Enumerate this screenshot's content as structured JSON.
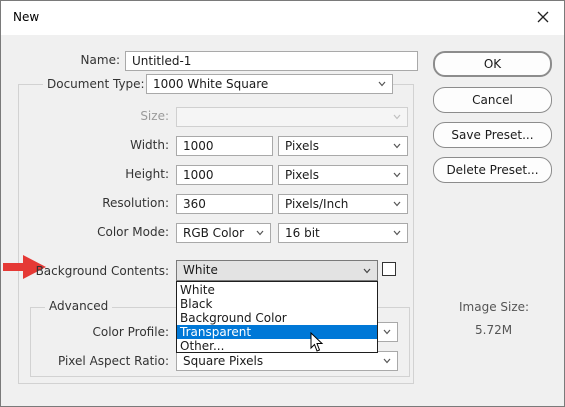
{
  "window": {
    "title": "New"
  },
  "form": {
    "name_label": "Name:",
    "name_value": "Untitled-1",
    "doctype_label": "Document Type:",
    "doctype_value": "1000 White Square",
    "size_label": "Size:",
    "size_value": "",
    "width_label": "Width:",
    "width_value": "1000",
    "width_unit": "Pixels",
    "height_label": "Height:",
    "height_value": "1000",
    "height_unit": "Pixels",
    "resolution_label": "Resolution:",
    "resolution_value": "360",
    "resolution_unit": "Pixels/Inch",
    "colormode_label": "Color Mode:",
    "colormode_value": "RGB Color",
    "bitdepth_value": "16 bit",
    "bg_label": "Background Contents:",
    "bg_value": "White",
    "bg_options": [
      "White",
      "Black",
      "Background Color",
      "Transparent",
      "Other..."
    ],
    "bg_highlighted": "Transparent"
  },
  "advanced": {
    "label": "Advanced",
    "profile_label": "Color Profile:",
    "pixel_aspect_label": "Pixel Aspect Ratio:",
    "pixel_aspect_value": "Square Pixels"
  },
  "buttons": {
    "ok": "OK",
    "cancel": "Cancel",
    "save_preset": "Save Preset...",
    "delete_preset": "Delete Preset..."
  },
  "image_size": {
    "label": "Image Size:",
    "value": "5.72M"
  },
  "colors": {
    "selection": "#0078d7",
    "annotation_arrow": "#e53935"
  },
  "icons": {
    "close": "close-icon",
    "dropdown": "chevron-down-icon",
    "pointer": "arrow-annotation-icon",
    "cursor": "mouse-cursor-icon"
  }
}
